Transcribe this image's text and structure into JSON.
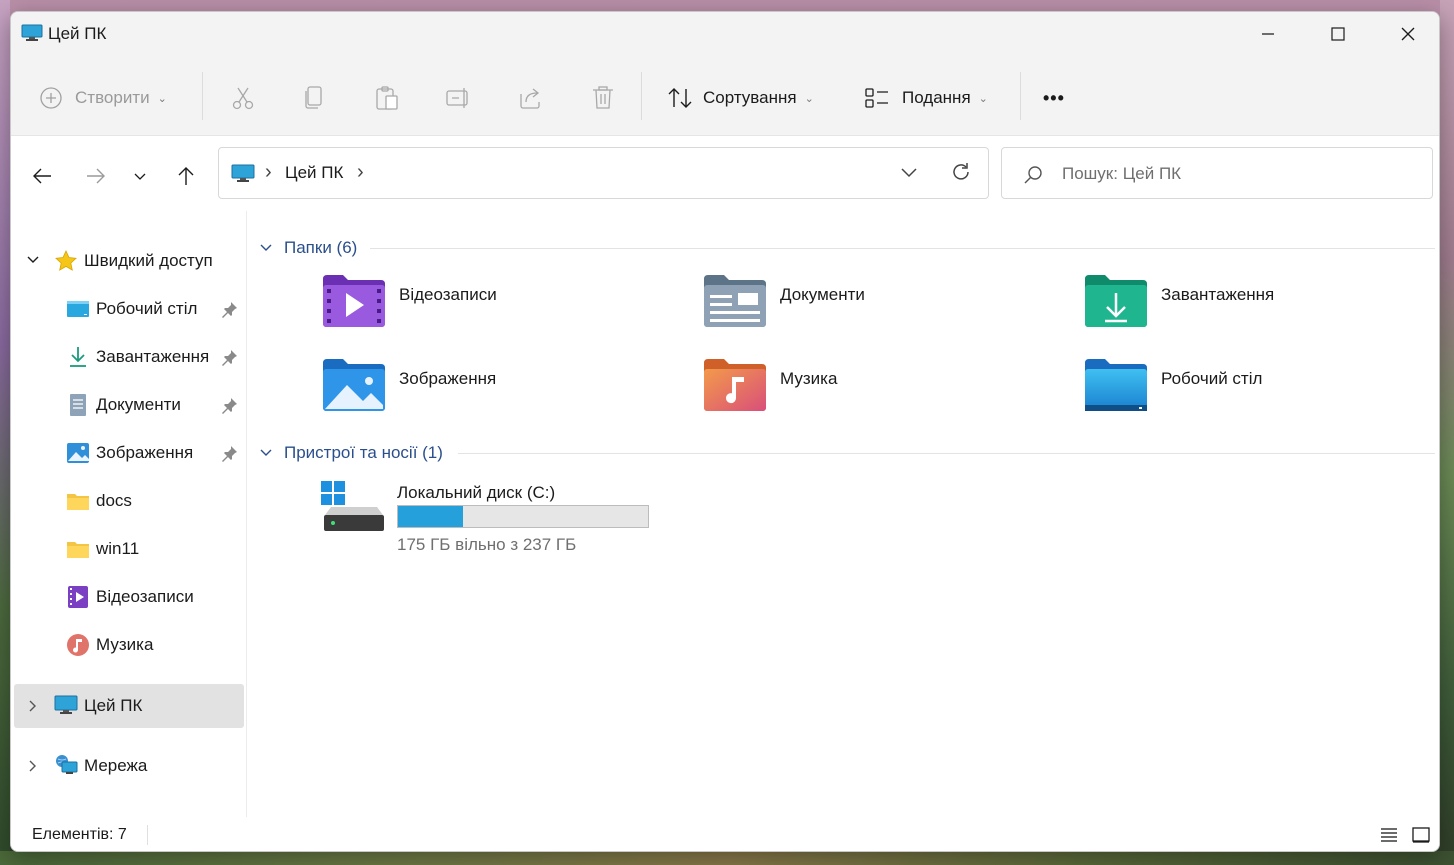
{
  "window": {
    "title": "Цей ПК"
  },
  "toolbar": {
    "new_label": "Створити",
    "sort_label": "Сортування",
    "view_label": "Подання",
    "more_label": "•••"
  },
  "navigation": {
    "address_segment": "Цей ПК",
    "search_placeholder": "Пошук: Цей ПК"
  },
  "sidebar": {
    "quick_access": "Швидкий доступ",
    "items": [
      {
        "label": "Робочий стіл",
        "pinned": true,
        "icon": "desktop-icon"
      },
      {
        "label": "Завантаження",
        "pinned": true,
        "icon": "download-icon"
      },
      {
        "label": "Документи",
        "pinned": true,
        "icon": "document-icon"
      },
      {
        "label": "Зображення",
        "pinned": true,
        "icon": "pictures-icon"
      },
      {
        "label": "docs",
        "pinned": false,
        "icon": "folder-icon"
      },
      {
        "label": "win11",
        "pinned": false,
        "icon": "folder-icon"
      },
      {
        "label": "Відеозаписи",
        "pinned": false,
        "icon": "videos-icon"
      },
      {
        "label": "Музика",
        "pinned": false,
        "icon": "music-icon"
      }
    ],
    "this_pc": "Цей ПК",
    "network": "Мережа"
  },
  "content": {
    "folders_header": "Папки (6)",
    "folders": [
      {
        "label": "Відеозаписи",
        "icon": "videos-folder-icon"
      },
      {
        "label": "Документи",
        "icon": "documents-folder-icon"
      },
      {
        "label": "Завантаження",
        "icon": "downloads-folder-icon"
      },
      {
        "label": "Зображення",
        "icon": "pictures-folder-icon"
      },
      {
        "label": "Музика",
        "icon": "music-folder-icon"
      },
      {
        "label": "Робочий стіл",
        "icon": "desktop-folder-icon"
      }
    ],
    "devices_header": "Пристрої та носії (1)",
    "drive": {
      "label": "Локальний диск (C:)",
      "free_text": "175 ГБ вільно з 237 ГБ",
      "used_fraction": 0.26
    }
  },
  "status": {
    "items_count": "Елементів: 7"
  },
  "colors": {
    "accent": "#26a0da",
    "group_header": "#2b4f8c",
    "selected_bg": "#e2e2e2"
  }
}
